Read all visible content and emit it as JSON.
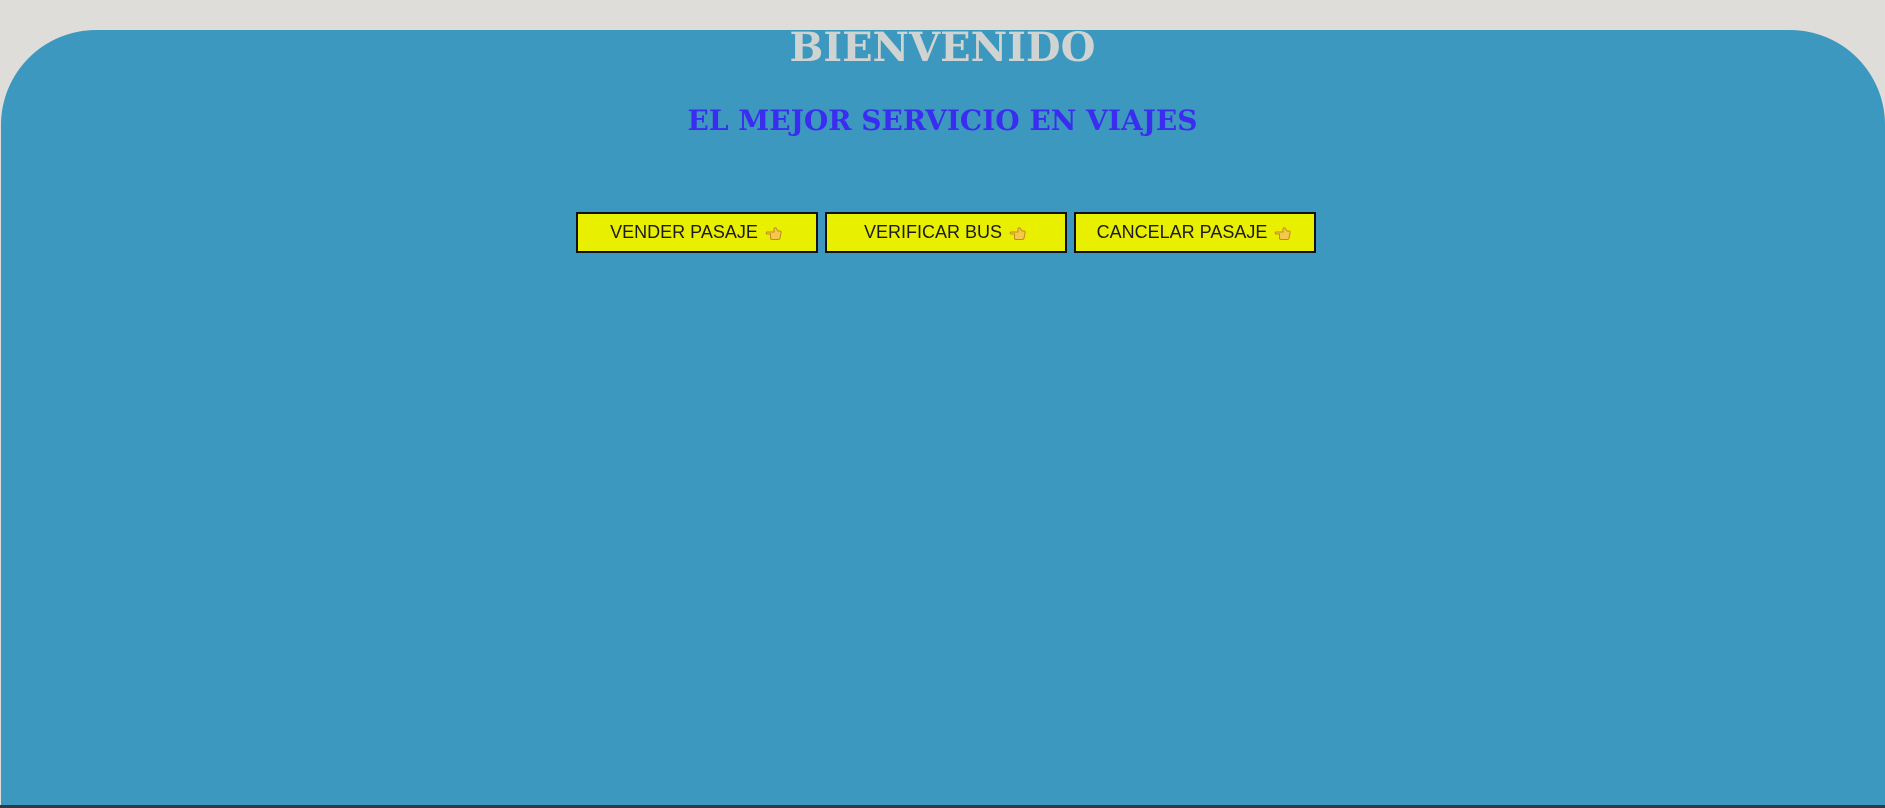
{
  "header": {
    "title": "BIENVENIDO",
    "subtitle": "EL MEJOR SERVICIO EN VIAJES"
  },
  "buttons": [
    {
      "label": "VENDER PASAJE",
      "icon": "pointing-hand-icon"
    },
    {
      "label": "VERIFICAR BUS",
      "icon": "pointing-hand-icon"
    },
    {
      "label": "CANCELAR PASAJE",
      "icon": "pointing-hand-icon"
    }
  ],
  "colors": {
    "page_background": "#deddda",
    "panel_background": "#3c98bf",
    "title": "#cfd4d2",
    "subtitle": "#3a2cf0",
    "button_background": "#e8ef00"
  }
}
